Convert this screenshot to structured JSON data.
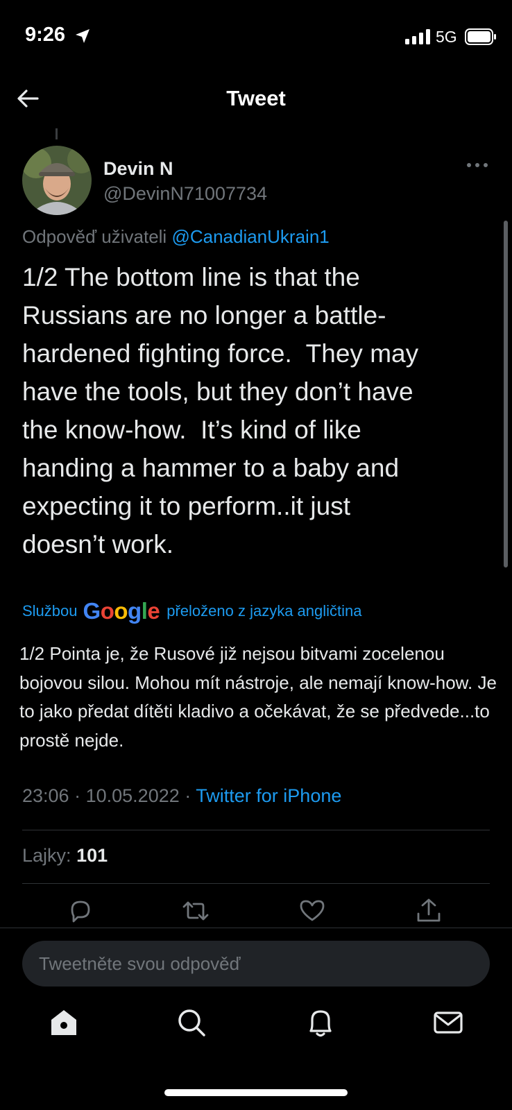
{
  "status_bar": {
    "time": "9:26",
    "network": "5G"
  },
  "header": {
    "title": "Tweet"
  },
  "tweet": {
    "author_name": "Devin N",
    "author_handle": "@DevinN71007734",
    "reply_prefix": "Odpověď uživateli",
    "reply_handle": "@CanadianUkrain1",
    "text": "1/2 The bottom line is that the\nRussians are no longer a battle-\nhardened fighting force.  They may\nhave the tools, but they don’t have\nthe know-how.  It’s kind of like\nhanding a hammer to a baby and\nexpecting it to perform..it just\ndoesn’t work.",
    "translation_prefix": "Službou",
    "translation_brand": "Google",
    "translation_suffix": "přeloženo z jazyka angličtina",
    "translated_text": "1/2 Pointa je, že Rusové již nejsou bitvami zocelenou bojovou silou. Mohou mít nástroje, ale nemají know-how. Je to jako předat dítěti kladivo a očekávat, že se předvede...to prostě nejde.",
    "time": "23:06",
    "date": "10.05.2022",
    "separator": "·",
    "source": "Twitter for iPhone",
    "likes_label": "Lajky:",
    "likes_count": "101"
  },
  "actions": [
    "reply-icon",
    "retweet-icon",
    "like-icon",
    "share-icon"
  ],
  "reply_box": {
    "placeholder": "Tweetněte svou odpověď"
  },
  "tabs": [
    "home-icon",
    "search-icon",
    "notifications-icon",
    "messages-icon"
  ],
  "colors": {
    "accent": "#1d9bf0",
    "background": "#000000",
    "muted": "#71767b",
    "text": "#e7e9ea"
  }
}
